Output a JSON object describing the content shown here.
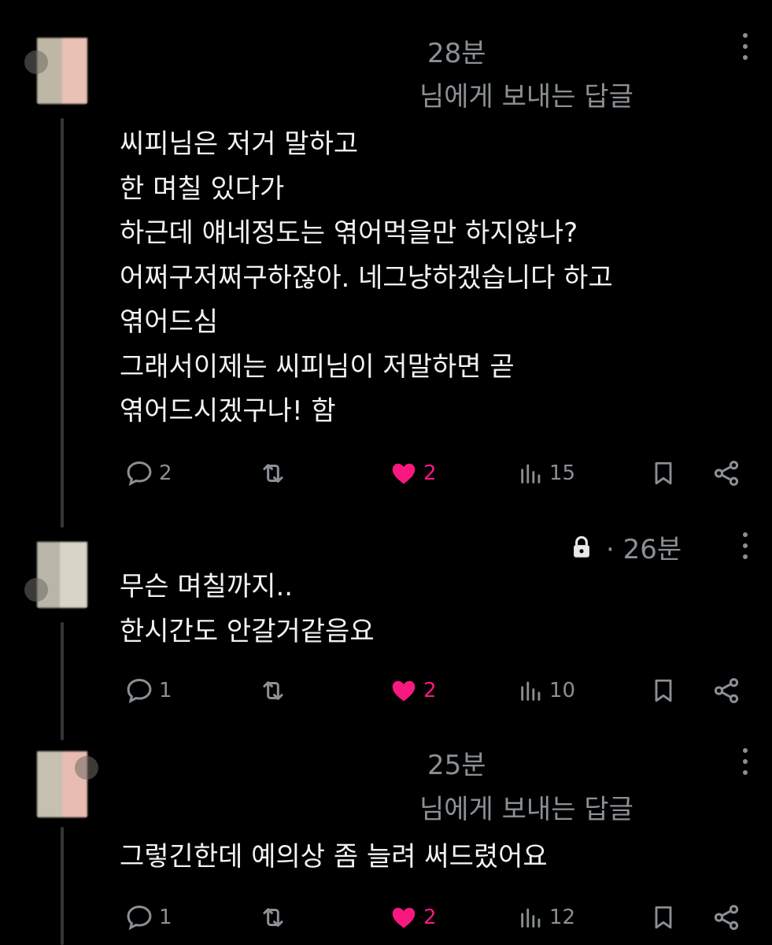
{
  "thread": [
    {
      "time": "28분",
      "reply_to": "님에게 보내는 답글",
      "lines": [
        "씨피님은 저거 말하고",
        "한 며칠 있다가",
        "하근데 얘네정도는 엮어먹을만 하지않나?",
        "어쩌구저쩌구하잖아. 네그냥하겠습니다 하고",
        "엮어드심",
        "그래서이제는 씨피님이 저말하면 곧",
        "엮어드시겠구나! 함"
      ],
      "actions": {
        "replies": "2",
        "likes": "2",
        "views": "15"
      }
    },
    {
      "time": "· 26분",
      "locked": true,
      "lines": [
        "무슨 며칠까지..",
        "한시간도 안갈거같음요"
      ],
      "actions": {
        "replies": "1",
        "likes": "2",
        "views": "10"
      }
    },
    {
      "time": "25분",
      "reply_to": "님에게 보내는 답글",
      "lines": [
        "그렇긴한데 예의상 좀 늘려 써드렸어요"
      ],
      "actions": {
        "replies": "1",
        "likes": "2",
        "views": "12"
      }
    }
  ],
  "icons": {
    "reply": "speech-bubble-icon",
    "retweet": "retweet-icon",
    "like": "heart-icon",
    "views": "bar-chart-icon",
    "bookmark": "bookmark-icon",
    "share": "share-icon",
    "lock": "lock-icon",
    "more": "more-vertical-icon"
  },
  "colors": {
    "background": "#000000",
    "text": "#f2f2f2",
    "muted": "#8b9095",
    "like": "#f91880"
  }
}
